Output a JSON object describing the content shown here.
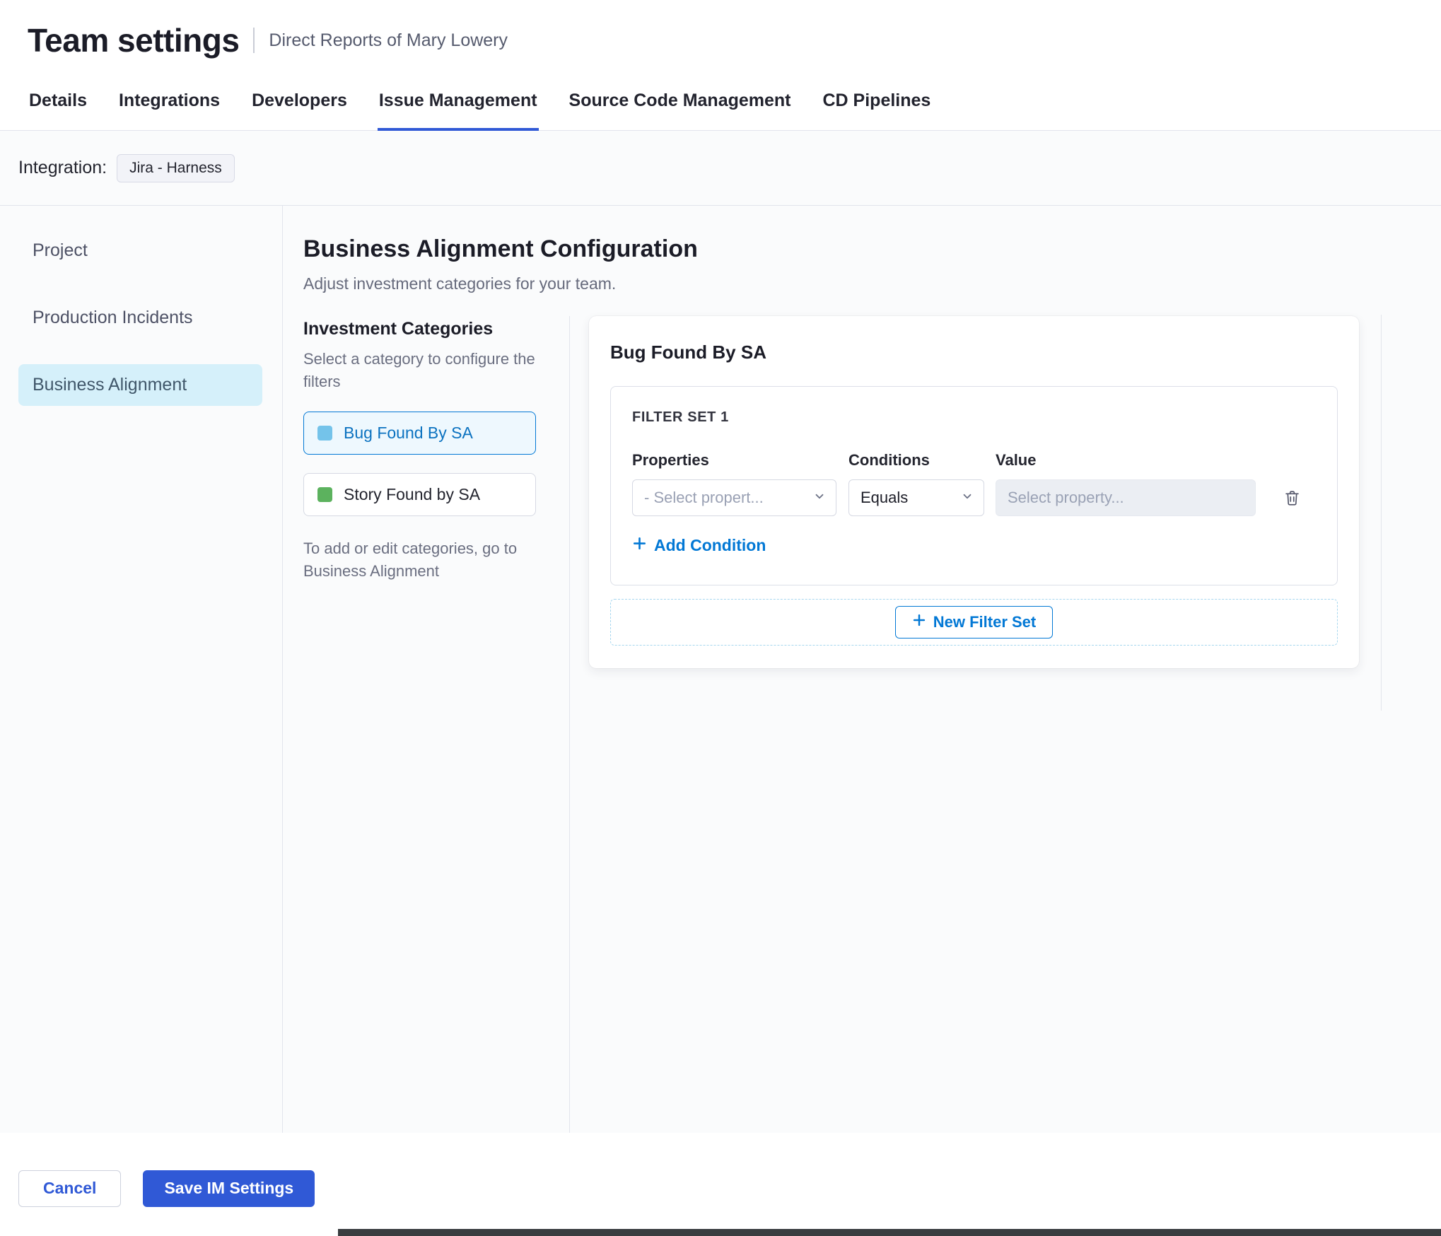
{
  "header": {
    "title": "Team settings",
    "subtitle": "Direct Reports of Mary Lowery"
  },
  "tabs": [
    {
      "label": "Details",
      "active": false
    },
    {
      "label": "Integrations",
      "active": false
    },
    {
      "label": "Developers",
      "active": false
    },
    {
      "label": "Issue Management",
      "active": true
    },
    {
      "label": "Source Code Management",
      "active": false
    },
    {
      "label": "CD Pipelines",
      "active": false
    }
  ],
  "integration_bar": {
    "label": "Integration:",
    "chip": "Jira - Harness"
  },
  "sidebar": {
    "items": [
      {
        "label": "Project",
        "active": false
      },
      {
        "label": "Production Incidents",
        "active": false
      },
      {
        "label": "Business Alignment",
        "active": true
      }
    ]
  },
  "main": {
    "title": "Business Alignment Configuration",
    "subtitle": "Adjust investment categories for your team.",
    "categories": {
      "title": "Investment Categories",
      "hint": "Select a category to configure the filters",
      "items": [
        {
          "label": "Bug Found By SA",
          "swatch_color": "#74c3ea",
          "selected": true
        },
        {
          "label": "Story Found by SA",
          "swatch_color": "#5cb25e",
          "selected": false
        }
      ],
      "footnote": "To add or edit categories, go to Business Alignment"
    },
    "panel": {
      "title": "Bug Found By SA",
      "filter_set": {
        "title": "FILTER SET 1",
        "columns": [
          "Properties",
          "Conditions",
          "Value"
        ],
        "property_placeholder": "- Select propert...",
        "condition_value": "Equals",
        "value_placeholder": "Select property...",
        "add_condition_label": "Add Condition"
      },
      "new_filter_set_label": "New Filter Set"
    }
  },
  "footer": {
    "cancel_label": "Cancel",
    "save_label": "Save IM Settings"
  },
  "icons": {
    "select_chevron": "chevron-down",
    "delete_row": "trash",
    "add": "plus",
    "category_swatch": "square"
  },
  "colors": {
    "accent_blue": "#0278d5",
    "primary_button_blue": "#3059d6",
    "selected_nav_bg": "#d5f0fa",
    "selected_category_bg": "#eef8fe",
    "category_swatch_blue": "#74c3ea",
    "category_swatch_green": "#5cb25e"
  }
}
